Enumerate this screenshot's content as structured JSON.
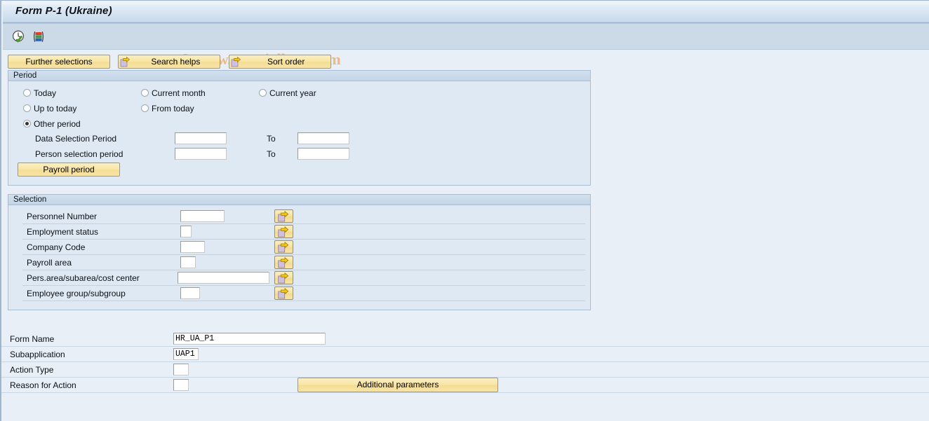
{
  "window": {
    "title": "Form P-1 (Ukraine)"
  },
  "toolbar": {
    "icons": [
      {
        "name": "execute-icon",
        "title": "Execute (F8)"
      },
      {
        "name": "variant-icon",
        "title": "Get Variant"
      }
    ],
    "watermark": "© www.tutorialkart.com"
  },
  "button_row": {
    "further_selections": "Further selections",
    "search_helps": "Search helps",
    "sort_order": "Sort order"
  },
  "period": {
    "header": "Period",
    "radios": [
      {
        "label": "Today",
        "checked": false
      },
      {
        "label": "Current month",
        "checked": false
      },
      {
        "label": "Current year",
        "checked": false
      },
      {
        "label": "Up to today",
        "checked": false
      },
      {
        "label": "From today",
        "checked": false
      },
      {
        "label": "Other period",
        "checked": true
      }
    ],
    "fields": [
      {
        "label": "Data Selection Period",
        "value": "",
        "to_label": "To",
        "to_value": ""
      },
      {
        "label": "Person selection period",
        "value": "",
        "to_label": "To",
        "to_value": ""
      }
    ],
    "payroll_period_button": "Payroll period"
  },
  "selection": {
    "header": "Selection",
    "rows": [
      {
        "label": "Personnel Number",
        "value": ""
      },
      {
        "label": "Employment status",
        "value": ""
      },
      {
        "label": "Company Code",
        "value": ""
      },
      {
        "label": "Payroll area",
        "value": ""
      },
      {
        "label": "Pers.area/subarea/cost center",
        "value": ""
      },
      {
        "label": "Employee group/subgroup",
        "value": ""
      }
    ],
    "multi_select_icon": "multi-select-arrow-icon"
  },
  "bottom_form": {
    "rows": [
      {
        "label": "Form Name",
        "value": "HR_UA_P1"
      },
      {
        "label": "Subapplication",
        "value": "UAP1"
      },
      {
        "label": "Action Type",
        "value": ""
      },
      {
        "label": "Reason for Action",
        "value": ""
      }
    ],
    "additional_parameters_button": "Additional parameters"
  },
  "colors": {
    "window_background": "#e9eff7",
    "toolbar_background": "#ccdae8",
    "group_background": "#dee9f3",
    "group_border": "#a9bed4",
    "button_yellow": "#f8e6a8",
    "watermark": "#ecb987"
  }
}
